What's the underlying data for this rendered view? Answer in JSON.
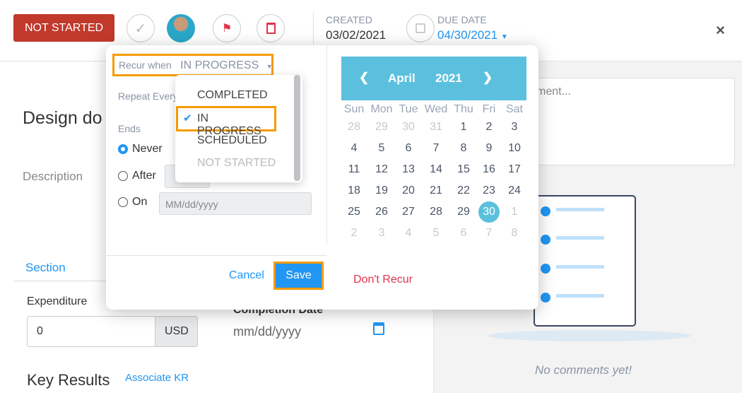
{
  "header": {
    "status": "NOT STARTED",
    "created_label": "CREATED",
    "created_value": "03/02/2021",
    "due_label": "DUE DATE",
    "due_value": "04/30/2021",
    "close": "×"
  },
  "main": {
    "title": "Design do",
    "description_label": "Description",
    "section_tab": "Section",
    "expenditure_label": "Expenditure",
    "expenditure_value": "0",
    "currency": "USD",
    "completion_label": "Completion Date",
    "completion_placeholder": "mm/dd/yyyy",
    "key_results": "Key Results",
    "associate_kr": "Associate KR"
  },
  "comments": {
    "placeholder_partial": "ment...",
    "empty": "No comments yet!"
  },
  "recur": {
    "label": "Recur when",
    "value": "IN PROGRESS",
    "repeat_label": "Repeat Every",
    "ends_label": "Ends",
    "never": "Never",
    "after": "After",
    "on": "On",
    "on_placeholder": "MM/dd/yyyy",
    "cancel": "Cancel",
    "save": "Save",
    "dont_recur": "Don't Recur",
    "options": [
      {
        "label": "COMPLETED",
        "selected": false
      },
      {
        "label": "IN PROGRESS",
        "selected": true
      },
      {
        "label": "SCHEDULED",
        "selected": false
      },
      {
        "label": "NOT STARTED",
        "selected": false,
        "disabled": true
      }
    ]
  },
  "calendar": {
    "month": "April",
    "year": "2021",
    "prev": "❮",
    "next": "❯",
    "weekdays": [
      "Sun",
      "Mon",
      "Tue",
      "Wed",
      "Thu",
      "Fri",
      "Sat"
    ],
    "weeks": [
      [
        "28",
        "29",
        "30",
        "31",
        "1",
        "2",
        "3"
      ],
      [
        "4",
        "5",
        "6",
        "7",
        "8",
        "9",
        "10"
      ],
      [
        "11",
        "12",
        "13",
        "14",
        "15",
        "16",
        "17"
      ],
      [
        "18",
        "19",
        "20",
        "21",
        "22",
        "23",
        "24"
      ],
      [
        "25",
        "26",
        "27",
        "28",
        "29",
        "30",
        "1"
      ],
      [
        "2",
        "3",
        "4",
        "5",
        "6",
        "7",
        "8"
      ]
    ],
    "selected": "30",
    "accent": "#5bc0de"
  },
  "colors": {
    "status": "#c0392b",
    "primary": "#2196f3",
    "highlight": "#f59b00",
    "danger": "#e0334d"
  }
}
